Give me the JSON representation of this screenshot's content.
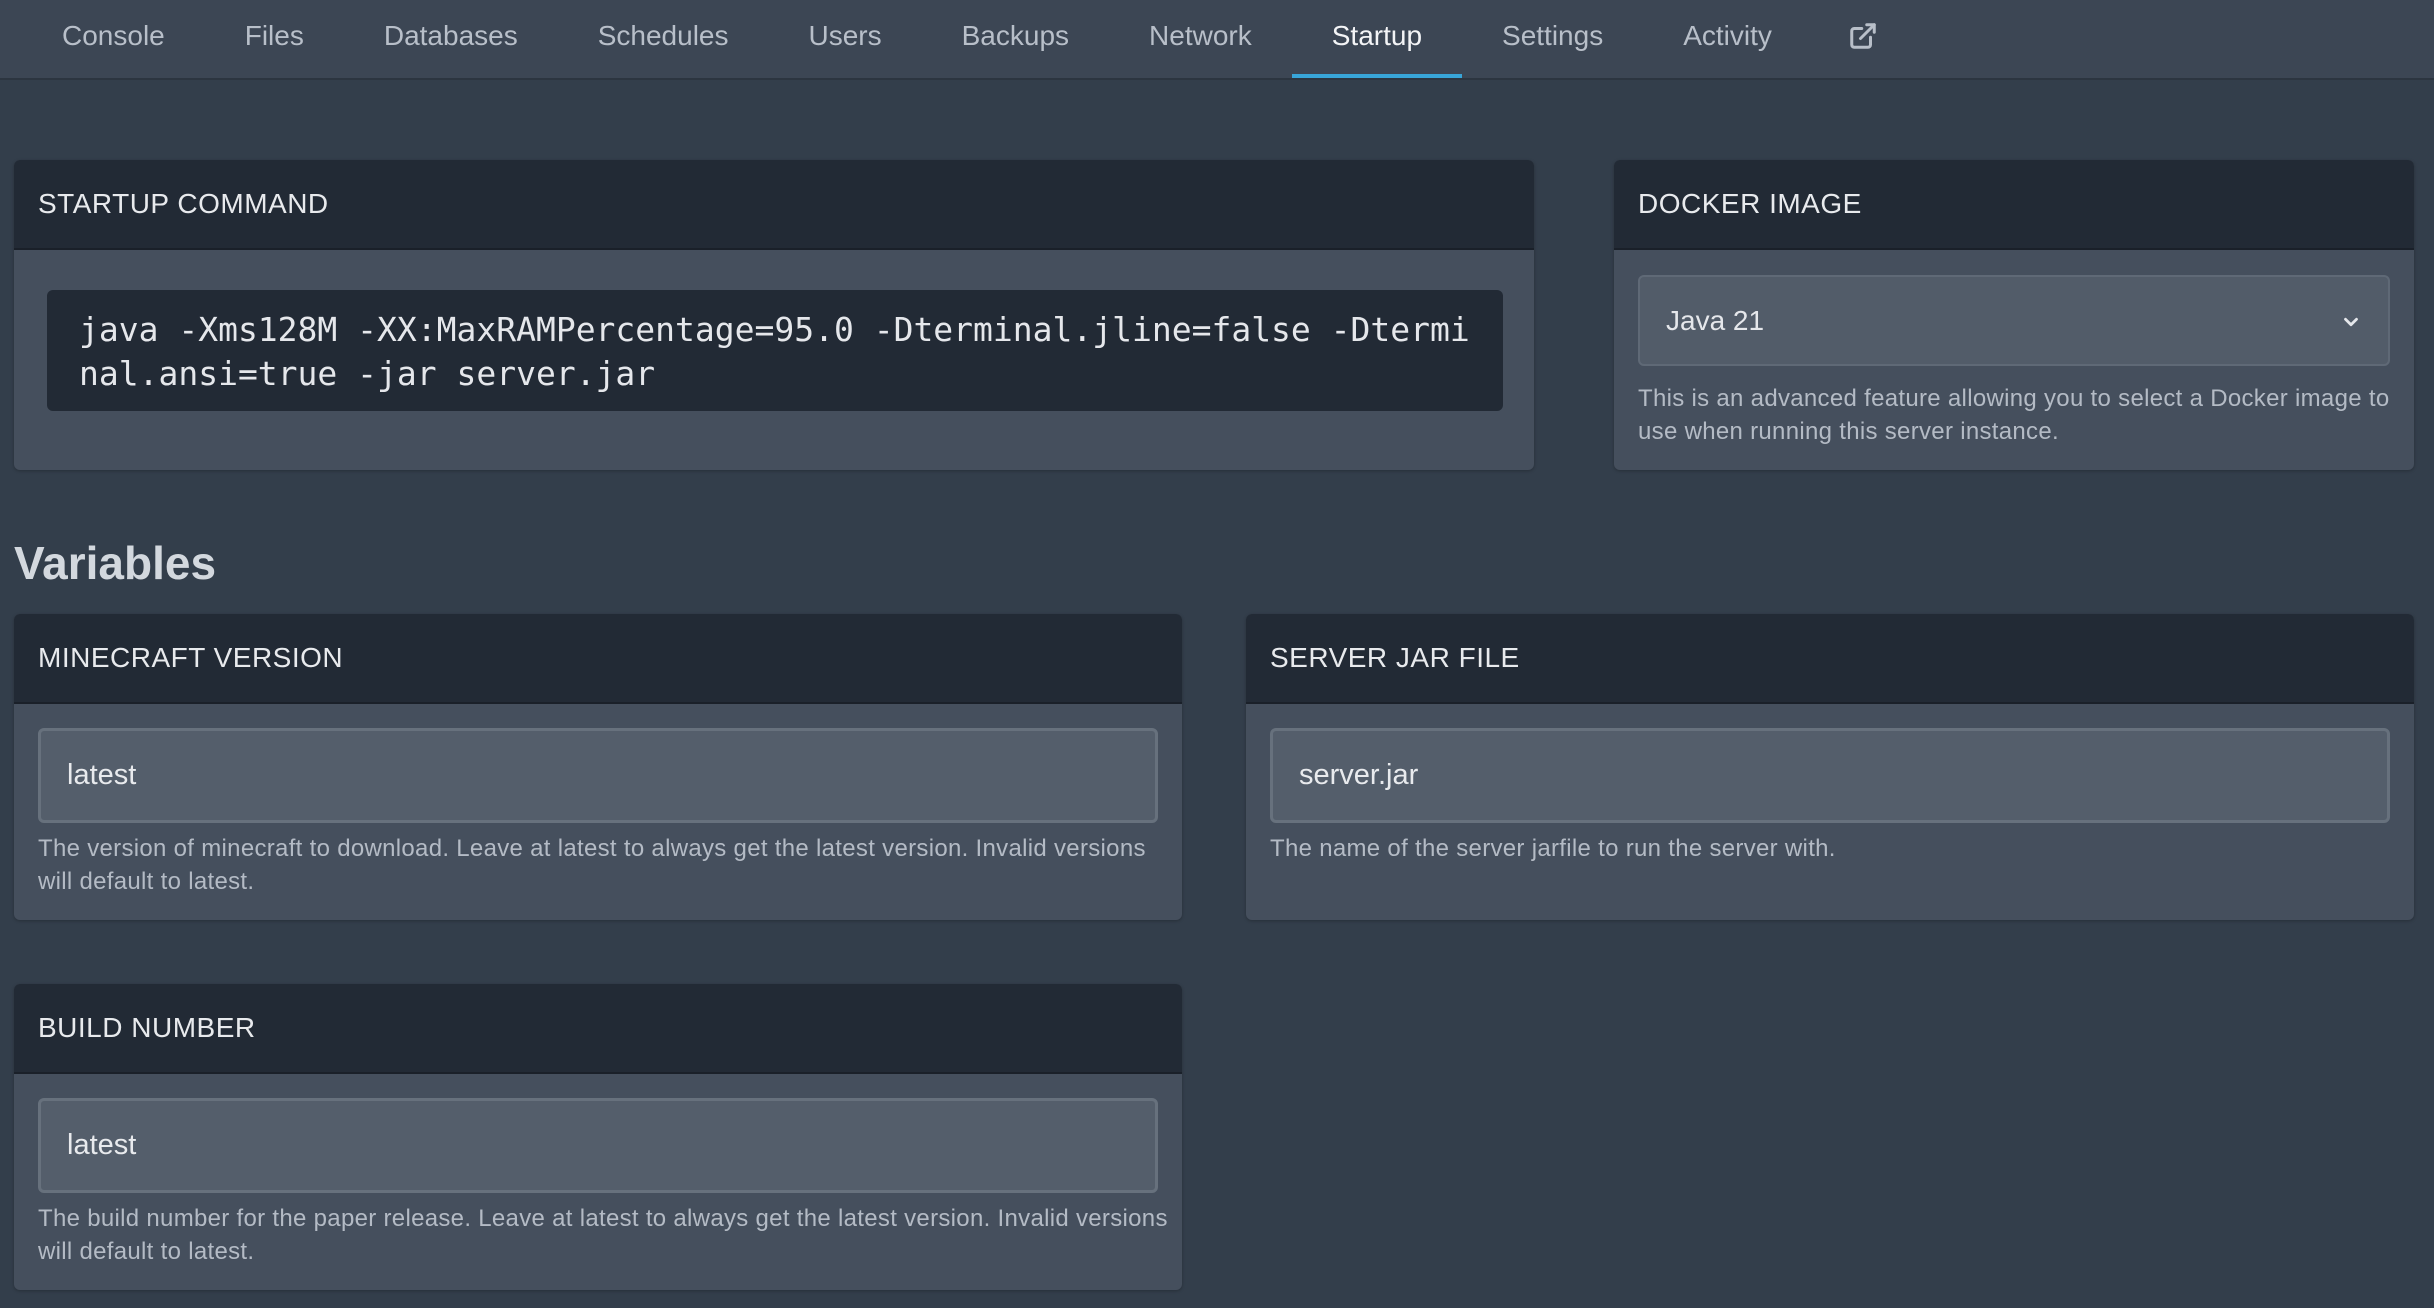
{
  "nav": {
    "tabs": [
      {
        "label": "Console"
      },
      {
        "label": "Files"
      },
      {
        "label": "Databases"
      },
      {
        "label": "Schedules"
      },
      {
        "label": "Users"
      },
      {
        "label": "Backups"
      },
      {
        "label": "Network"
      },
      {
        "label": "Startup",
        "active": true
      },
      {
        "label": "Settings"
      },
      {
        "label": "Activity"
      }
    ],
    "external_icon": "external-link-icon"
  },
  "startup": {
    "header": "STARTUP COMMAND",
    "command": "java -Xms128M -XX:MaxRAMPercentage=95.0 -Dterminal.jline=false -Dterminal.ansi=true -jar server.jar"
  },
  "docker": {
    "header": "DOCKER IMAGE",
    "selected": "Java 21",
    "help": "This is an advanced feature allowing you to select a Docker image to use when running this server instance."
  },
  "variables": {
    "title": "Variables",
    "minecraft_version": {
      "header": "MINECRAFT VERSION",
      "value": "latest",
      "help": "The version of minecraft to download. Leave at latest to always get the latest version. Invalid versions will default to latest."
    },
    "server_jar": {
      "header": "SERVER JAR FILE",
      "value": "server.jar",
      "help": "The name of the server jarfile to run the server with."
    },
    "build_number": {
      "header": "BUILD NUMBER",
      "value": "latest",
      "help": "The build number for the paper release. Leave at latest to always get the latest version. Invalid versions will default to latest."
    }
  },
  "colors": {
    "accent": "#38a5d8",
    "background": "#333e4b",
    "card": "#454f5d",
    "card_header": "#222a35"
  }
}
